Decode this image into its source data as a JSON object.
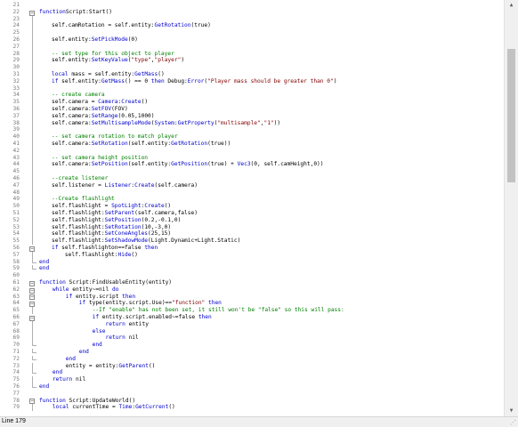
{
  "status": {
    "text": "Line 179"
  },
  "scrollbar": {
    "up_icon": "▲",
    "down_icon": "▼",
    "grip_icon": "⋰"
  },
  "lines": [
    {
      "n": "21",
      "fold": "",
      "segs": []
    },
    {
      "n": "22",
      "fold": "box",
      "segs": [
        [
          "kw",
          "function"
        ],
        [
          "",
          "Script:Start()"
        ]
      ]
    },
    {
      "n": "23",
      "fold": "vline",
      "segs": []
    },
    {
      "n": "24",
      "fold": "vline",
      "segs": [
        [
          "",
          "self.camRotation = self.entity:"
        ],
        [
          "kw",
          "GetRotation"
        ],
        [
          "",
          "(true)"
        ]
      ]
    },
    {
      "n": "25",
      "fold": "vline",
      "segs": []
    },
    {
      "n": "26",
      "fold": "vline",
      "segs": [
        [
          "",
          "self.entity:"
        ],
        [
          "kw",
          "SetPickMode"
        ],
        [
          "",
          "(0)"
        ]
      ]
    },
    {
      "n": "27",
      "fold": "vline",
      "segs": []
    },
    {
      "n": "28",
      "fold": "vline",
      "segs": [
        [
          "cm",
          "-- set type for this object to player"
        ]
      ]
    },
    {
      "n": "29",
      "fold": "vline",
      "segs": [
        [
          "",
          "self.entity:"
        ],
        [
          "kw",
          "SetKeyValue"
        ],
        [
          "",
          "("
        ],
        [
          "st",
          "\"type\""
        ],
        [
          "",
          ","
        ],
        [
          "st",
          "\"player\""
        ],
        [
          "",
          ")"
        ]
      ]
    },
    {
      "n": "30",
      "fold": "vline",
      "segs": []
    },
    {
      "n": "31",
      "fold": "vline",
      "segs": [
        [
          "kw",
          "local"
        ],
        [
          "",
          " mass = self.entity:"
        ],
        [
          "kw",
          "GetMass"
        ],
        [
          "",
          "()"
        ]
      ]
    },
    {
      "n": "32",
      "fold": "vline",
      "segs": [
        [
          "kw",
          "if"
        ],
        [
          "",
          " self.entity:"
        ],
        [
          "kw",
          "GetMass"
        ],
        [
          "",
          "() == 0 "
        ],
        [
          "kw",
          "then"
        ],
        [
          "",
          " Debug:"
        ],
        [
          "kw",
          "Error"
        ],
        [
          "",
          "("
        ],
        [
          "st",
          "\"Player mass should be greater than 0\""
        ],
        [
          "",
          ")"
        ]
      ]
    },
    {
      "n": "33",
      "fold": "vline",
      "segs": []
    },
    {
      "n": "34",
      "fold": "vline",
      "segs": [
        [
          "cm",
          "-- create camera"
        ]
      ]
    },
    {
      "n": "35",
      "fold": "vline",
      "segs": [
        [
          "",
          "self.camera = "
        ],
        [
          "kw",
          "Camera"
        ],
        [
          "",
          ":"
        ],
        [
          "kw",
          "Create"
        ],
        [
          "",
          "()"
        ]
      ]
    },
    {
      "n": "36",
      "fold": "vline",
      "segs": [
        [
          "",
          "self.camera:"
        ],
        [
          "kw",
          "SetFOV"
        ],
        [
          "",
          "(FOV)"
        ]
      ]
    },
    {
      "n": "37",
      "fold": "vline",
      "segs": [
        [
          "",
          "self.camera:"
        ],
        [
          "kw",
          "SetRange"
        ],
        [
          "",
          "(0.05,1000)"
        ]
      ]
    },
    {
      "n": "38",
      "fold": "vline",
      "segs": [
        [
          "",
          "self.camera:"
        ],
        [
          "kw",
          "SetMultisampleMode"
        ],
        [
          "",
          "("
        ],
        [
          "kw",
          "System"
        ],
        [
          "",
          ":"
        ],
        [
          "kw",
          "GetProperty"
        ],
        [
          "",
          "("
        ],
        [
          "st",
          "\"multisample\""
        ],
        [
          "",
          ","
        ],
        [
          "st",
          "\"1\""
        ],
        [
          "",
          "))"
        ]
      ]
    },
    {
      "n": "39",
      "fold": "vline",
      "segs": []
    },
    {
      "n": "40",
      "fold": "vline",
      "segs": [
        [
          "cm",
          "-- set camera rotation to match player"
        ]
      ]
    },
    {
      "n": "41",
      "fold": "vline",
      "segs": [
        [
          "",
          "self.camera:"
        ],
        [
          "kw",
          "SetRotation"
        ],
        [
          "",
          "(self.entity:"
        ],
        [
          "kw",
          "GetRotation"
        ],
        [
          "",
          "(true))"
        ]
      ]
    },
    {
      "n": "42",
      "fold": "vline",
      "segs": []
    },
    {
      "n": "43",
      "fold": "vline",
      "segs": [
        [
          "cm",
          "-- set camera height position"
        ]
      ]
    },
    {
      "n": "44",
      "fold": "vline",
      "segs": [
        [
          "",
          "self.camera:"
        ],
        [
          "kw",
          "SetPosition"
        ],
        [
          "",
          "(self.entity:"
        ],
        [
          "kw",
          "GetPosition"
        ],
        [
          "",
          "(true) + "
        ],
        [
          "kw",
          "Vec3"
        ],
        [
          "",
          "(0, self.camHeight,0))"
        ]
      ]
    },
    {
      "n": "45",
      "fold": "vline",
      "segs": []
    },
    {
      "n": "46",
      "fold": "vline",
      "segs": [
        [
          "cm",
          "--create listener"
        ]
      ]
    },
    {
      "n": "47",
      "fold": "vline",
      "segs": [
        [
          "",
          "self.listener = "
        ],
        [
          "kw",
          "Listener"
        ],
        [
          "",
          ":"
        ],
        [
          "kw",
          "Create"
        ],
        [
          "",
          "(self.camera)"
        ]
      ]
    },
    {
      "n": "48",
      "fold": "vline",
      "segs": []
    },
    {
      "n": "49",
      "fold": "vline",
      "segs": [
        [
          "cm",
          "--Create flashlight"
        ]
      ]
    },
    {
      "n": "50",
      "fold": "vline",
      "segs": [
        [
          "",
          "self.flashlight = "
        ],
        [
          "kw",
          "SpotLight"
        ],
        [
          "",
          ":"
        ],
        [
          "kw",
          "Create"
        ],
        [
          "",
          "()"
        ]
      ]
    },
    {
      "n": "51",
      "fold": "vline",
      "segs": [
        [
          "",
          "self.flashlight:"
        ],
        [
          "kw",
          "SetParent"
        ],
        [
          "",
          "(self.camera,false)"
        ]
      ]
    },
    {
      "n": "52",
      "fold": "vline",
      "segs": [
        [
          "",
          "self.flashlight:"
        ],
        [
          "kw",
          "SetPosition"
        ],
        [
          "",
          "(0.2,-0.1,0)"
        ]
      ]
    },
    {
      "n": "53",
      "fold": "vline",
      "segs": [
        [
          "",
          "self.flashlight:"
        ],
        [
          "kw",
          "SetRotation"
        ],
        [
          "",
          "(10,-3,0)"
        ]
      ]
    },
    {
      "n": "54",
      "fold": "vline",
      "segs": [
        [
          "",
          "self.flashlight:"
        ],
        [
          "kw",
          "SetConeAngles"
        ],
        [
          "",
          "(25,15)"
        ]
      ]
    },
    {
      "n": "55",
      "fold": "vline",
      "segs": [
        [
          "",
          "self.flashlight:"
        ],
        [
          "kw",
          "SetShadowMode"
        ],
        [
          "",
          "(Light.Dynamic+Light.Static)"
        ]
      ]
    },
    {
      "n": "56",
      "fold": "box",
      "segs": [
        [
          "kw",
          "if"
        ],
        [
          "",
          " self.flashlighton==false "
        ],
        [
          "kw",
          "then"
        ]
      ]
    },
    {
      "n": "57",
      "fold": "vline",
      "segs": [
        [
          "",
          "    self.flashlight:"
        ],
        [
          "kw",
          "Hide"
        ],
        [
          "",
          "()"
        ]
      ]
    },
    {
      "n": "58",
      "fold": "end",
      "segs": [
        [
          "kw",
          "end"
        ]
      ]
    },
    {
      "n": "59",
      "fold": "end",
      "segs": [
        [
          "kw",
          "end"
        ]
      ]
    },
    {
      "n": "60",
      "fold": "",
      "segs": []
    },
    {
      "n": "61",
      "fold": "box",
      "segs": [
        [
          "kw",
          "function"
        ],
        [
          "",
          " Script:FindUsableEntity(entity)"
        ]
      ]
    },
    {
      "n": "62",
      "fold": "box",
      "segs": [
        [
          "kw",
          "    while"
        ],
        [
          "",
          " entity~=nil "
        ],
        [
          "kw",
          "do"
        ]
      ]
    },
    {
      "n": "63",
      "fold": "box",
      "segs": [
        [
          "kw",
          "        if"
        ],
        [
          "",
          " entity.script "
        ],
        [
          "kw",
          "then"
        ]
      ]
    },
    {
      "n": "64",
      "fold": "box",
      "segs": [
        [
          "kw",
          "            if"
        ],
        [
          "",
          " type(entity.script.Use)=="
        ],
        [
          "st",
          "\"function\""
        ],
        [
          "kw",
          " then"
        ]
      ]
    },
    {
      "n": "65",
      "fold": "vline",
      "segs": [
        [
          "cm",
          "                --If \"enable\" has not been set, it still won't be \"false\" so this will pass:"
        ]
      ]
    },
    {
      "n": "66",
      "fold": "box",
      "segs": [
        [
          "kw",
          "                if"
        ],
        [
          "",
          " entity.script.enabled~=false "
        ],
        [
          "kw",
          "then"
        ]
      ]
    },
    {
      "n": "67",
      "fold": "vline",
      "segs": [
        [
          "kw",
          "                    return"
        ],
        [
          "",
          " entity"
        ]
      ]
    },
    {
      "n": "68",
      "fold": "vline",
      "segs": [
        [
          "kw",
          "                else"
        ]
      ]
    },
    {
      "n": "69",
      "fold": "vline",
      "segs": [
        [
          "kw",
          "                    return"
        ],
        [
          "",
          " nil"
        ]
      ]
    },
    {
      "n": "70",
      "fold": "end",
      "segs": [
        [
          "kw",
          "                end"
        ]
      ]
    },
    {
      "n": "71",
      "fold": "end",
      "segs": [
        [
          "kw",
          "            end"
        ]
      ]
    },
    {
      "n": "72",
      "fold": "end",
      "segs": [
        [
          "kw",
          "        end"
        ]
      ]
    },
    {
      "n": "73",
      "fold": "vline",
      "segs": [
        [
          "",
          "        entity = entity:"
        ],
        [
          "kw",
          "GetParent"
        ],
        [
          "",
          "()"
        ]
      ]
    },
    {
      "n": "74",
      "fold": "end",
      "segs": [
        [
          "kw",
          "    end"
        ]
      ]
    },
    {
      "n": "75",
      "fold": "vline",
      "segs": [
        [
          "kw",
          "    return"
        ],
        [
          "",
          " nil"
        ]
      ]
    },
    {
      "n": "76",
      "fold": "end",
      "segs": [
        [
          "kw",
          "end"
        ]
      ]
    },
    {
      "n": "77",
      "fold": "",
      "segs": []
    },
    {
      "n": "78",
      "fold": "box",
      "segs": [
        [
          "kw",
          "function"
        ],
        [
          "",
          " Script:UpdateWorld()"
        ]
      ]
    },
    {
      "n": "79",
      "fold": "vline",
      "segs": [
        [
          "kw",
          "    local"
        ],
        [
          "",
          " currentTime = "
        ],
        [
          "kw",
          "Time"
        ],
        [
          "",
          ":"
        ],
        [
          "kw",
          "GetCurrent"
        ],
        [
          "",
          "()"
        ]
      ]
    }
  ]
}
